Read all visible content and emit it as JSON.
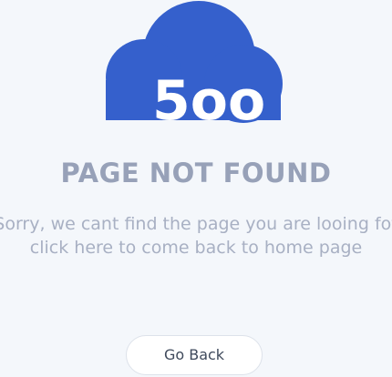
{
  "hero": {
    "code_text": "5oo",
    "cloud_color": "#3560cc",
    "icon": "cloud-icon"
  },
  "heading": "PAGE NOT FOUND",
  "message": {
    "line1": "Sorry, we cant find the page you are looing fot",
    "line2": "click here to come back to home page"
  },
  "actions": {
    "go_back_label": "Go Back"
  },
  "colors": {
    "background": "#f4f7fb",
    "heading": "#97a1b8",
    "message": "#a8b0c3",
    "button_border": "#dde2ea"
  }
}
